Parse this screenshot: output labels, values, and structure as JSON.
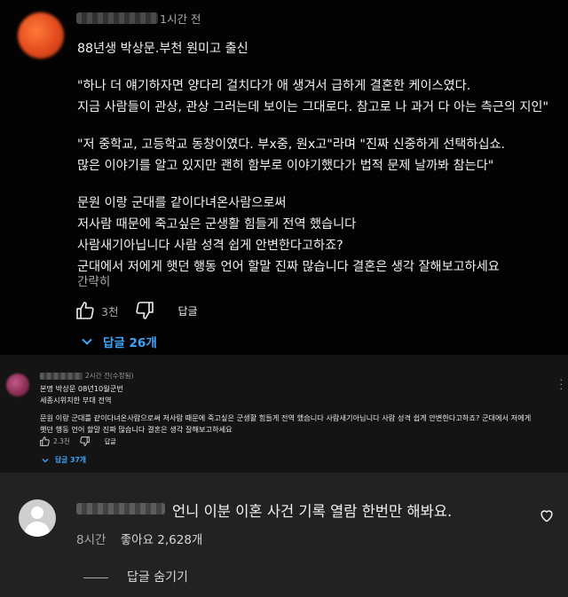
{
  "comment1": {
    "time": "1시간 전",
    "lines": [
      "88년생 박상문.부천 원미고 출신",
      "",
      "\"하나 더 얘기하자면 양다리 걸치다가 애 생겨서 급하게 결혼한 케이스였다.",
      "지금 사람들이 관상, 관상 그러는데 보이는 그대로다. 참고로 나 과거 다 아는 측근의 지인\"",
      "",
      "\"저 중학교, 고등학교 동창이였다. 부x중, 원x고\"라며 \"진짜 신중하게 선택하십쇼.",
      "많은 이야기를 알고 있지만 괜히 함부로 이야기했다가 법적 문제 날까봐 참는다\"",
      "",
      "문원 이랑 군대를 같이다녀온사람으로써",
      "저사람 때문에 죽고싶은 군생활 힘들게 전역 했습니다",
      "사람새기아닙니다 사람 성격 쉽게 안변한다고하죠?",
      "군대에서 저에게 햇던 행동 언어 할말 진짜 많습니다 결혼은 생각 잘해보고하세요"
    ],
    "read_more": "간략히",
    "like_count": "3천",
    "reply_label": "답글",
    "replies_toggle": "답글 26개"
  },
  "comment2": {
    "time": "2시간 전(수정됨)",
    "lines": [
      "본명 박상문 08년10월군번",
      "세종시위치한 부대 전역",
      "",
      "문원 이랑 군대를 같이다녀온사람으로써 저사람 때문에 죽고싶은 군생활 힘들게 전역 했습니다 사람새기아닙니다 사람 성격 쉽게 안변한다고하죠? 군대에서 저에게",
      "햇던 행동 언어 할말 진짜 많습니다 결혼은 생각 잘해보고하세요"
    ],
    "like_count": "2.3천",
    "reply_label": "답글",
    "replies_toggle": "답글 37개"
  },
  "comment3": {
    "text": "언니 이분 이혼 사건 기록 열람 한번만 해봐요.",
    "time": "8시간",
    "likes": "좋아요 2,628개",
    "hide_replies": "답글 숨기기"
  },
  "colors": {
    "link_blue": "#3ea6ff",
    "secondary_text": "#aaaaaa"
  },
  "icons": [
    "thumb-up-icon",
    "thumb-down-icon",
    "chevron-down-icon",
    "more-vert-icon",
    "heart-icon",
    "default-avatar-icon"
  ]
}
